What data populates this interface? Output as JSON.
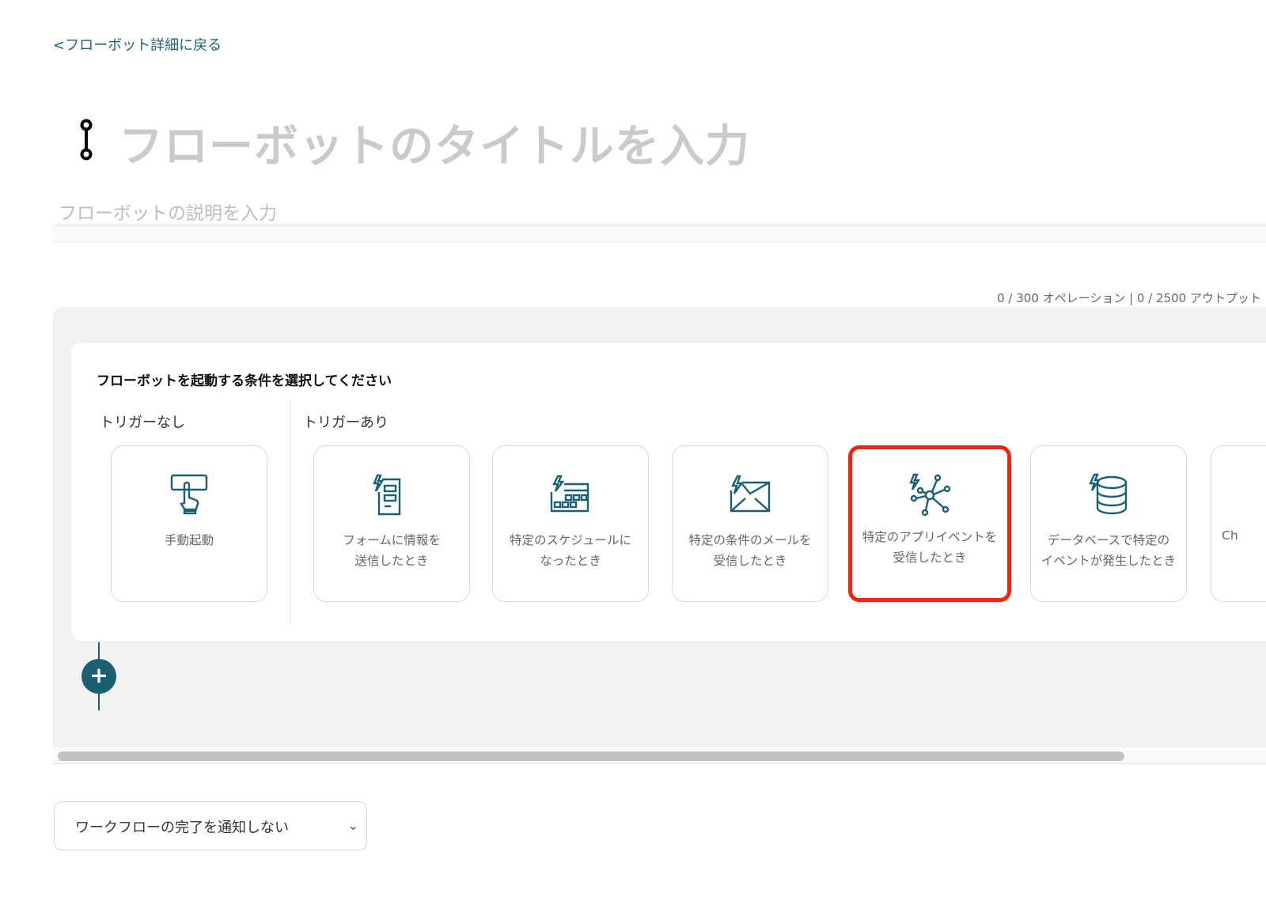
{
  "back_link": "<フローボット詳細に戻る",
  "title_placeholder": "フローボットのタイトルを入力",
  "description_placeholder": "フローボットの説明を入力",
  "usage": "0 / 300 オペレーション | 0 / 2500 アウトプット",
  "panel": {
    "heading": "フローボットを起動する条件を選択してください",
    "no_trigger_label": "トリガーなし",
    "trigger_label": "トリガーあり",
    "cards": [
      {
        "label": "手動起動",
        "icon": "hand-press-icon"
      },
      {
        "label": "フォームに情報を\n送信したとき",
        "icon": "form-icon"
      },
      {
        "label": "特定のスケジュールに\nなったとき",
        "icon": "calendar-icon"
      },
      {
        "label": "特定の条件のメールを\n受信したとき",
        "icon": "mail-icon"
      },
      {
        "label": "特定のアプリイベントを\n受信したとき",
        "icon": "app-event-icon",
        "selected": true
      },
      {
        "label": "データベースで特定の\nイベントが発生したとき",
        "icon": "database-icon"
      },
      {
        "label": "Ch",
        "icon": ""
      }
    ]
  },
  "add_button": "+",
  "notify_select": {
    "value": "ワークフローの完了を通知しない"
  },
  "colors": {
    "accent": "#1b5f73",
    "highlight": "#f0250f"
  }
}
